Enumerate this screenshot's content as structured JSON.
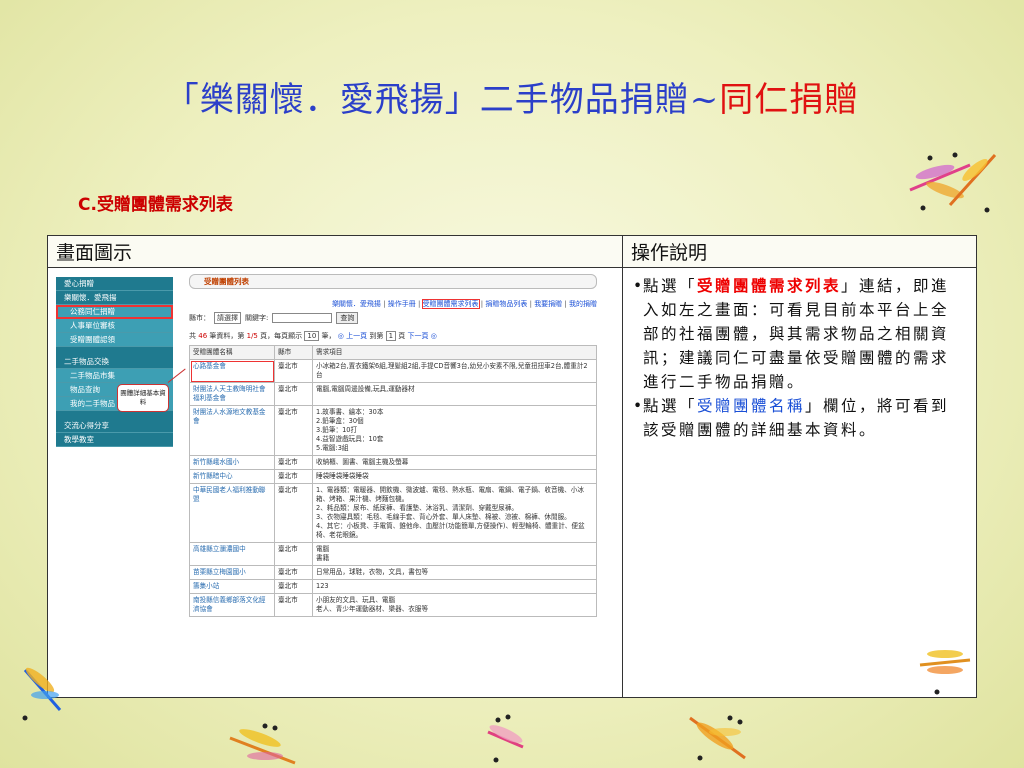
{
  "slide": {
    "title_blue": "「樂關懷．愛飛揚」二手物品捐贈~",
    "title_red": "同仁捐贈",
    "subtitle_letter": "C.",
    "subtitle_text": "受贈團體需求列表"
  },
  "table": {
    "col1_header": "畫面圖示",
    "col2_header": "操作說明"
  },
  "description": {
    "bullet1_pre": "點選「",
    "bullet1_red": "受贈團體需求列表",
    "bullet1_post": "」連結，即進入如左之畫面：可看見目前本平台上全部的社福團體，與其需求物品之相關資訊；建議同仁可盡量依受贈團體的需求進行二手物品捐贈。",
    "bullet2_pre": "點選「",
    "bullet2_blue": "受贈團體名稱",
    "bullet2_post": "」欄位，將可看到該受贈團體的詳細基本資料。"
  },
  "screenshot": {
    "sidebar": [
      {
        "label": "愛心捐贈",
        "type": "top"
      },
      {
        "label": "樂關懷．愛飛揚",
        "type": "top"
      },
      {
        "label": "公務同仁捐贈",
        "type": "sub",
        "selected": true
      },
      {
        "label": "人事單位審核",
        "type": "sub"
      },
      {
        "label": "受贈團體認領",
        "type": "sub"
      },
      {
        "label": "二手物品交換",
        "type": "top"
      },
      {
        "label": "二手物品市集",
        "type": "sub"
      },
      {
        "label": "物品查詢",
        "type": "sub"
      },
      {
        "label": "我的二手物品",
        "type": "sub"
      },
      {
        "label": "交流心得分享",
        "type": "top"
      },
      {
        "label": "教學教室",
        "type": "top"
      }
    ],
    "page_title": "受贈團體列表",
    "links": [
      "樂關懷．愛飛揚",
      "操作手冊",
      "受贈團體需求列表",
      "捐贈物品列表",
      "我要捐贈",
      "我的捐贈"
    ],
    "filter": {
      "city_label": "縣市：",
      "city_value": "請選擇",
      "keyword_label": "關鍵字:",
      "search_button": "查詢"
    },
    "pager": {
      "text1": "共",
      "total": "46",
      "text2": "筆資料，第",
      "page": "1/5",
      "text3": "頁，每頁顯示",
      "per_page": "10",
      "text4": "筆，",
      "prev": "上一頁",
      "text5": "到第",
      "goto": "1",
      "text6": "頁",
      "next": "下一頁"
    },
    "columns": [
      "受贈團體名稱",
      "縣市",
      "需求項目"
    ],
    "rows": [
      {
        "org": "心路基金會",
        "city": "臺北市",
        "needs": "小冰箱2台,置衣鐵架6組,理髮組2組,手提CD音響3台,幼兒小安素不限,兒童扭扭車2台,體重計2台",
        "selected": true
      },
      {
        "org": "財團法人天主教晦明社會福利基金會",
        "city": "臺北市",
        "needs": "電腦,電腦周邊設備,玩具,運動器材"
      },
      {
        "org": "財團法人水源地文教基金會",
        "city": "臺北市",
        "needs": "1.故事書、繪本：30本\n2.鉛筆盒：30個\n3.鉛筆：10打\n4.益智遊戲玩具：10套\n5.電腦:3組"
      },
      {
        "org": "新竹縣峨水國小",
        "city": "臺北市",
        "needs": "收納櫃、圖書、電腦主機及螢幕"
      },
      {
        "org": "新竹縣暗中心",
        "city": "臺北市",
        "needs": "睡袋睡袋睡袋睡袋"
      },
      {
        "org": "中華民國老人福利推動聯盟",
        "city": "臺北市",
        "needs": "1、電器類：電暖器、開飲機、微波爐、電毯、熱水瓶、電扇、電鍋、電子鍋、收音機、小冰箱、烤箱、果汁機、烤麵包機。\n2、耗品類：尿布、紙尿褲、看護墊、沐浴乳、清潔劑、穿戴型尿褲。\n3、衣物寢具類：毛毯、毛線手套、背心外套、單人床墊、棉被、涼被、棉褲、休閒服。\n4、其它：小板凳、手電筒、錐他命、血壓計(功能簡單,方便操作)、輕型輪椅、體重計、便盆椅、老花眼鏡。"
      },
      {
        "org": "高雄縣立瀰濃國中",
        "city": "臺北市",
        "needs": "電腦\n書籍"
      },
      {
        "org": "苗栗縣立梅園國小",
        "city": "臺北市",
        "needs": "日常用品，球鞋，衣物，文具，書包等"
      },
      {
        "org": "籌集小站",
        "city": "臺北市",
        "needs": "123"
      },
      {
        "org": "南投縣信義鄉部落文化經濟協會",
        "city": "臺北市",
        "needs": "小朋友的文具、玩具、電腦\n老人、青少年運動器材、樂器、衣服等"
      }
    ],
    "callout": "團體詳細基本資料"
  }
}
